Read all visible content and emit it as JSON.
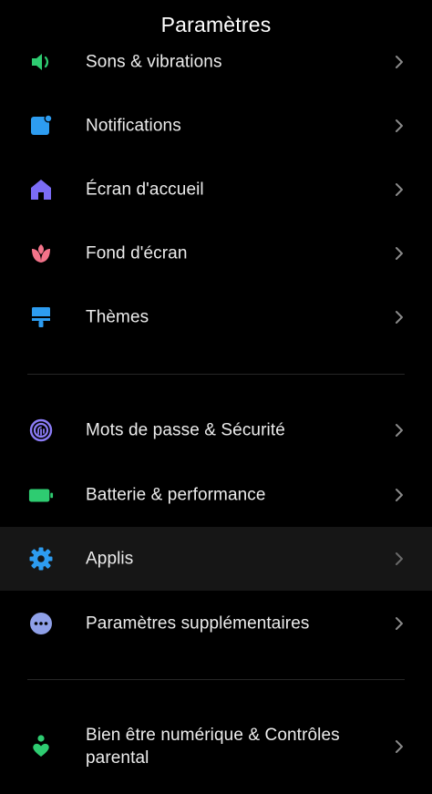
{
  "header": {
    "title": "Paramètres"
  },
  "groups": [
    {
      "items": [
        {
          "id": "sound",
          "label": "Sons & vibrations",
          "icon": "speaker-icon",
          "icon_color": "#2ecc71"
        },
        {
          "id": "notifications",
          "label": "Notifications",
          "icon": "notification-icon",
          "icon_color": "#2d9cf0"
        },
        {
          "id": "home",
          "label": "Écran d'accueil",
          "icon": "home-icon",
          "icon_color": "#7b6cf6"
        },
        {
          "id": "wallpaper",
          "label": "Fond d'écran",
          "icon": "flower-icon",
          "icon_color": "#f4738a"
        },
        {
          "id": "themes",
          "label": "Thèmes",
          "icon": "brush-icon",
          "icon_color": "#2d9cf0"
        }
      ]
    },
    {
      "items": [
        {
          "id": "security",
          "label": "Mots de passe & Sécurité",
          "icon": "fingerprint-icon",
          "icon_color": "#8b7cf6"
        },
        {
          "id": "battery",
          "label": "Batterie & performance",
          "icon": "battery-icon",
          "icon_color": "#2ecc71"
        },
        {
          "id": "apps",
          "label": "Applis",
          "icon": "gear-icon",
          "icon_color": "#2d9cf0",
          "highlighted": true
        },
        {
          "id": "additional",
          "label": "Paramètres supplémentaires",
          "icon": "more-dots-icon",
          "icon_color": "#8fa0e8"
        }
      ]
    },
    {
      "items": [
        {
          "id": "wellbeing",
          "label": "Bien être numérique & Contrôles parental",
          "icon": "wellbeing-icon",
          "icon_color": "#2ecc71"
        }
      ]
    }
  ],
  "theme": {
    "background": "#000000",
    "text": "#ececec",
    "chevron": "#8a8a8a",
    "divider": "#262626",
    "highlight": "#161616"
  }
}
